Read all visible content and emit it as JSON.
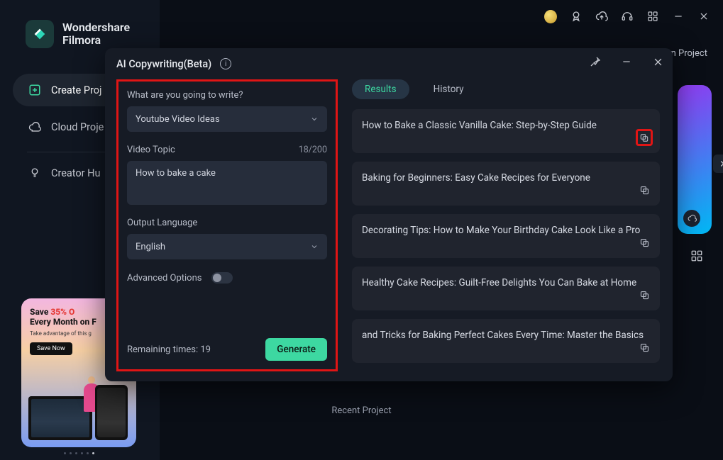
{
  "app": {
    "brand_line1": "Wondershare",
    "brand_line2": "Filmora"
  },
  "sidebar": {
    "items": [
      {
        "label": "Create Proj"
      },
      {
        "label": "Cloud Proje"
      },
      {
        "label": "Creator Hu"
      }
    ]
  },
  "promo": {
    "headline_prefix": "Save ",
    "headline_accent": "35% O",
    "headline_line2": "Every Month on F",
    "subtext": "Take advantage of this g",
    "cta": "Save Now"
  },
  "ghost": {
    "project_btn": "en Project"
  },
  "modal": {
    "title": "AI Copywriting(Beta)",
    "left": {
      "prompt_label": "What are you going to write?",
      "write_type": "Youtube Video Ideas",
      "topic_label": "Video Topic",
      "char_counter": "18/200",
      "topic_value": "How to bake a cake",
      "output_lang_label": "Output Language",
      "output_lang_value": "English",
      "advanced_label": "Advanced Options",
      "remaining_label": "Remaining times: 19",
      "generate_label": "Generate"
    },
    "right": {
      "tab_results": "Results",
      "tab_history": "History",
      "results": [
        "How to Bake a Classic Vanilla Cake: Step-by-Step Guide",
        "Baking for Beginners: Easy Cake Recipes for Everyone",
        "Decorating Tips: How to Make Your Birthday Cake Look Like a Pro",
        "Healthy Cake Recipes: Guilt-Free Delights You Can Bake at Home",
        "and Tricks for Baking Perfect Cakes Every Time: Master the Basics"
      ]
    }
  },
  "footer": {
    "recent_label": "Recent Project"
  }
}
